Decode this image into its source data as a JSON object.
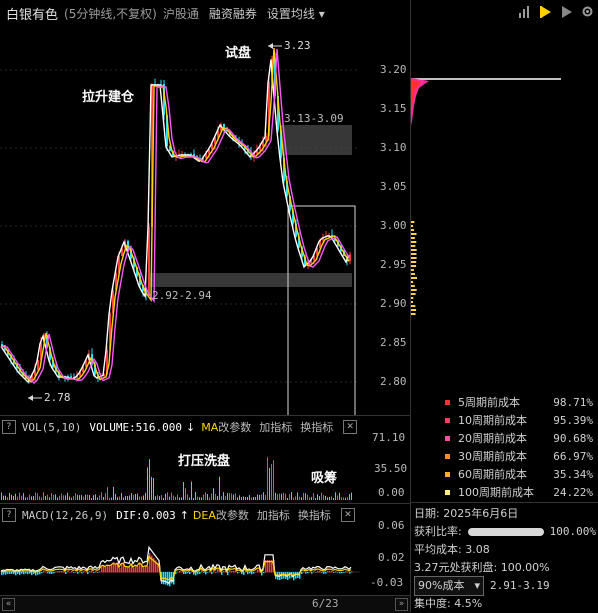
{
  "header": {
    "stock_name": "白银有色",
    "period": "(5分钟线,不复权)",
    "connect": "沪股通",
    "margin": "融资融券",
    "ma_setting": "设置均线"
  },
  "price_axis": {
    "labels": [
      "3.20",
      "3.15",
      "3.10",
      "3.05",
      "3.00",
      "2.95",
      "2.90",
      "2.85",
      "2.80"
    ]
  },
  "annotations": {
    "high_label": "3.23",
    "low_label": "2.78",
    "zone_upper": "3.13-3.09",
    "zone_lower": "2.92-2.94",
    "trial": "试盘",
    "pull_up": "拉升建仓",
    "wash": "打压洗盘",
    "absorb": "吸筹"
  },
  "volume_panel": {
    "name": "VOL(5,10)",
    "value_label": "VOLUME:516.000",
    "arrow": "↓",
    "ma": "MA",
    "modify": "改参数",
    "add": "加指标",
    "switch": "换指标",
    "axis": [
      "71.10",
      "35.50",
      "0.00"
    ]
  },
  "macd_panel": {
    "name": "MACD(12,26,9)",
    "dif": "DIF:0.003",
    "arrow": "↑",
    "dea": "DEA",
    "modify": "改参数",
    "add": "加指标",
    "switch": "换指标",
    "axis": [
      "0.06",
      "0.02",
      "-0.03"
    ]
  },
  "page_indicator": "6/23",
  "cost_legend": [
    {
      "name": "5周期前成本",
      "pct": "98.71%",
      "color": "#ff3030"
    },
    {
      "name": "10周期前成本",
      "pct": "95.39%",
      "color": "#ff3c64"
    },
    {
      "name": "20周期前成本",
      "pct": "90.68%",
      "color": "#ff4fa0"
    },
    {
      "name": "30周期前成本",
      "pct": "66.97%",
      "color": "#ff8a2a"
    },
    {
      "name": "60周期前成本",
      "pct": "35.34%",
      "color": "#ffb020"
    },
    {
      "name": "100周期前成本",
      "pct": "24.22%",
      "color": "#fff080"
    }
  ],
  "chip_info": {
    "date": "日期: 2025年6月6日",
    "profit_label": "获利比率:",
    "profit_pct": "100.00%",
    "avg_cost": "平均成本: 3.08",
    "profit_at": "3.27元处获利盘: 100.00%",
    "cost_select": "90%成本",
    "cost_range": "2.91-3.19",
    "concentration": "集中度: 4.5%"
  },
  "colors": {
    "up": "#ff3b3b",
    "down": "#20e0ff",
    "ma1": "#ffffff",
    "ma2": "#ffd700",
    "ma3": "#ff55ff",
    "grid": "#333333"
  }
}
